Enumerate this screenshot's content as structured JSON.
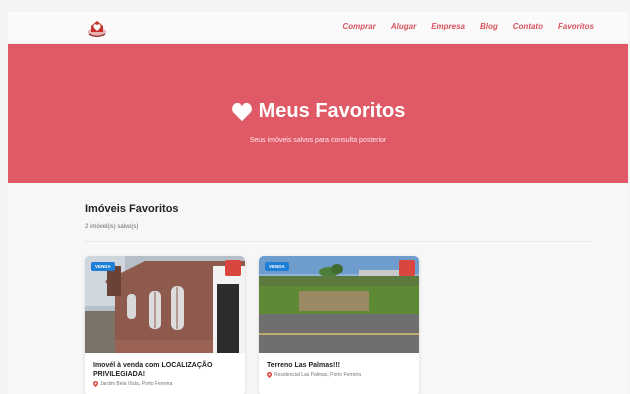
{
  "nav": {
    "items": [
      "Comprar",
      "Alugar",
      "Empresa",
      "Blog",
      "Contato",
      "Favoritos"
    ]
  },
  "hero": {
    "title": "Meus Favoritos",
    "subtitle": "Seus imóveis salvos para consulta posterior"
  },
  "favorites": {
    "title": "Imóveis Favoritos",
    "count_text": "2 imóvel(is) salvo(s)",
    "cards": [
      {
        "badge": "VENDA",
        "title": "Imovél à venda com LOCALIZAÇÃO PRIVILEGIADA!",
        "location": "Jardim Bela Vista, Porto Ferreira"
      },
      {
        "badge": "VENDA",
        "title": "Terreno Las Palmas!!!",
        "location": "Residencial Las Palmas, Porto Ferreira"
      }
    ]
  },
  "colors": {
    "brand": "#df5a66",
    "nav_link": "#d9535f",
    "badge": "#1e7fd6",
    "fav_button": "#d9463f"
  },
  "icons": {
    "logo": "house-heart-logo",
    "hero": "heart-icon",
    "location": "map-pin-icon"
  }
}
